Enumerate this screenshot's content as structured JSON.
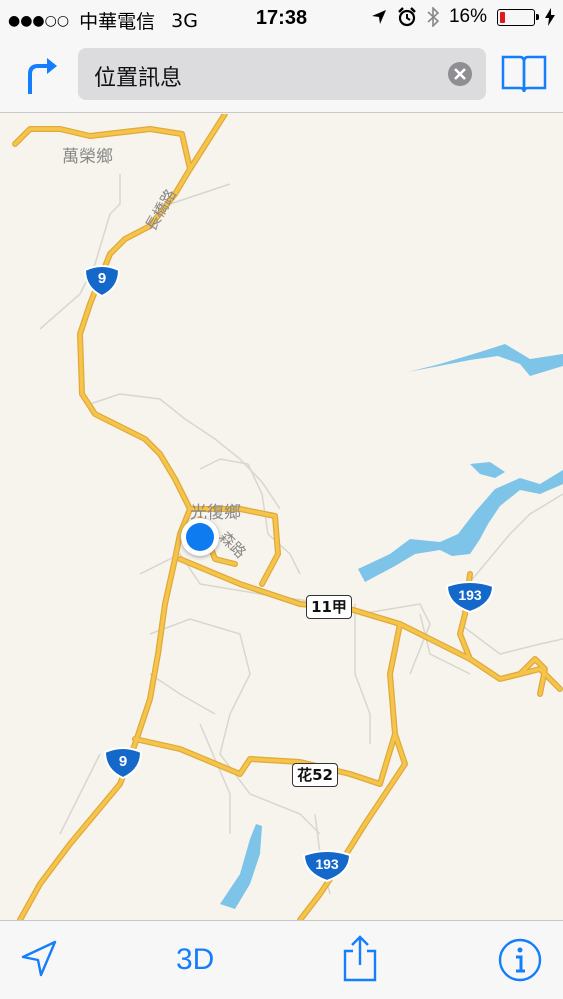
{
  "status_bar": {
    "signal": "●●●○○",
    "carrier": "中華電信",
    "network": "3G",
    "time": "17:38",
    "battery_percent": "16%",
    "battery_level": 0.16,
    "icons": [
      "location-arrow-icon",
      "alarm-clock-icon",
      "bluetooth-icon",
      "charging-bolt-icon"
    ]
  },
  "search": {
    "query": "位置訊息"
  },
  "map": {
    "places": {
      "wanrong": "萬榮鄉",
      "guangfu": "光復鄉"
    },
    "roads": {
      "changqiao": "長橋路",
      "road_partial": "森路"
    },
    "route_shields": {
      "nine_top": "9",
      "nine_bottom": "9",
      "r193_right": "193",
      "r193_bottom": "193"
    },
    "route_boxes": {
      "r11a": "11甲",
      "hua52": "花52"
    },
    "colors": {
      "land": "#f7f4ee",
      "road": "#f5c44a",
      "road_outline": "#e0a93a",
      "water": "#7ec3e8",
      "minor_road": "#d9d6d0",
      "shield": "#1468c9",
      "user_location": "#0f7bf0"
    }
  },
  "toolbar": {
    "three_d_label": "3D"
  },
  "accent_color": "#157efb"
}
